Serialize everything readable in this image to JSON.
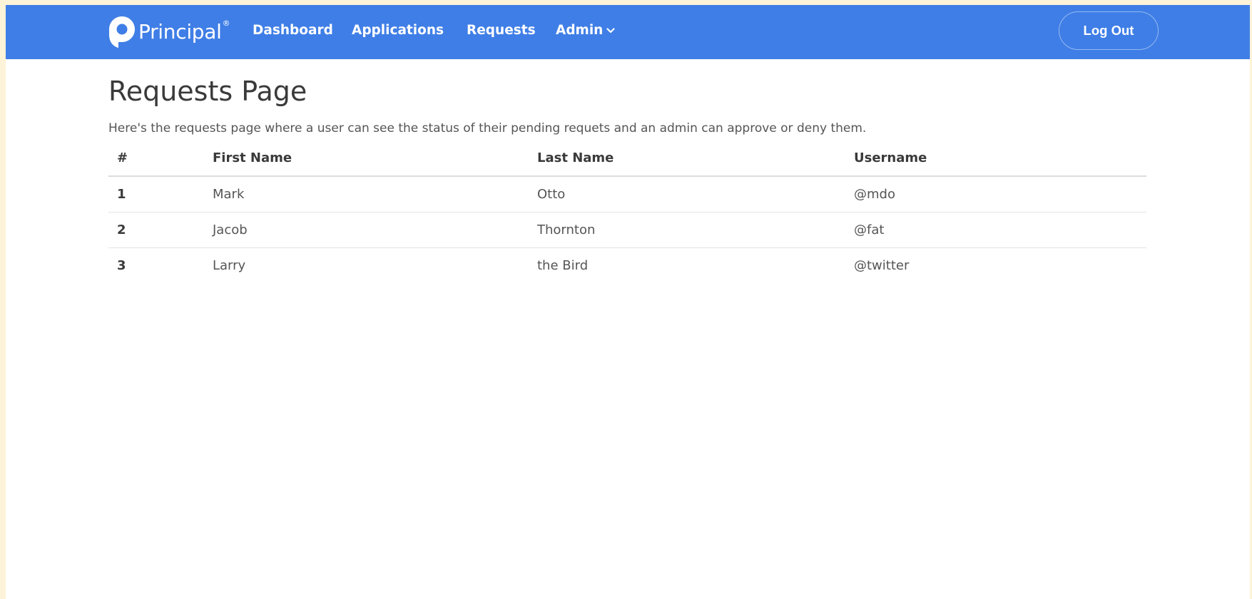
{
  "nav": {
    "brand": "Principal",
    "brand_mark": "®",
    "links": [
      "Dashboard",
      "Applications",
      "Requests",
      "Admin"
    ],
    "logout": "Log Out"
  },
  "page": {
    "title": "Requests Page",
    "description": "Here's the requests page where a user can see the status of their pending requets and an admin can approve or deny them."
  },
  "table": {
    "headers": [
      "#",
      "First Name",
      "Last Name",
      "Username"
    ],
    "rows": [
      [
        "1",
        "Mark",
        "Otto",
        "@mdo"
      ],
      [
        "2",
        "Jacob",
        "Thornton",
        "@fat"
      ],
      [
        "3",
        "Larry",
        "the Bird",
        "@twitter"
      ]
    ]
  },
  "colors": {
    "nav_background": "#3f7ee6",
    "page_background": "#ffffff",
    "outer_background": "#fdf3d8"
  },
  "icons": {
    "logo": "principal-logo-icon",
    "admin_dropdown": "chevron-down-icon"
  }
}
